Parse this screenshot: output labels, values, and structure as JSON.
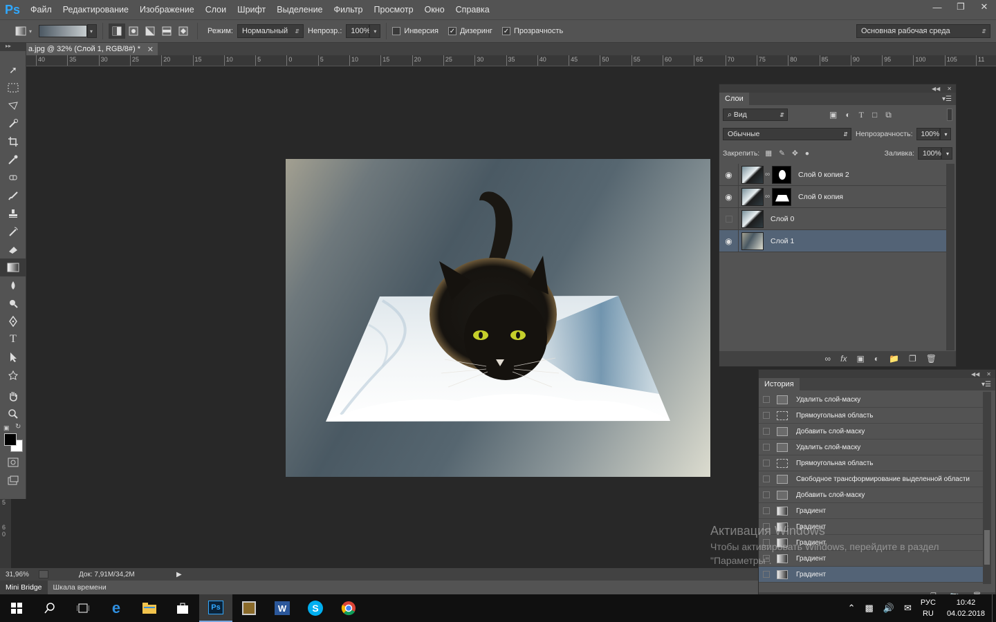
{
  "app": {
    "logo": "Ps",
    "menu": [
      "Файл",
      "Редактирование",
      "Изображение",
      "Слои",
      "Шрифт",
      "Выделение",
      "Фильтр",
      "Просмотр",
      "Окно",
      "Справка"
    ],
    "window_controls": [
      "minimize",
      "restore",
      "close"
    ]
  },
  "options": {
    "mode_label": "Режим:",
    "mode_value": "Нормальный",
    "opacity_label": "Непрозр.:",
    "opacity_value": "100%",
    "inverse_label": "Инверсия",
    "inverse_checked": false,
    "dither_label": "Дизеринг",
    "dither_checked": true,
    "transparency_label": "Прозрачность",
    "transparency_checked": true,
    "workspace": "Основная рабочая среда"
  },
  "document": {
    "tab_title": "a.jpg @ 32% (Слой 1, RGB/8#) *",
    "ruler_ticks": [
      "40",
      "35",
      "30",
      "25",
      "20",
      "15",
      "10",
      "5",
      "0",
      "5",
      "10",
      "15",
      "20",
      "25",
      "30",
      "35",
      "40",
      "45",
      "50",
      "55",
      "60",
      "65",
      "70",
      "75",
      "80",
      "85",
      "90",
      "95",
      "100",
      "105",
      "11"
    ],
    "vertical_ruler": [
      "5",
      "6",
      "0"
    ]
  },
  "status": {
    "zoom": "31,96%",
    "doc_size": "Док: 7,91M/34,2M"
  },
  "bottom_tabs": [
    "Mini Bridge",
    "Шкала времени"
  ],
  "layers_panel": {
    "tab": "Слои",
    "filter": "Вид",
    "blend": "Обычные",
    "opacity_label": "Непрозрачность:",
    "opacity_value": "100%",
    "lock_label": "Закрепить:",
    "fill_label": "Заливка:",
    "fill_value": "100%",
    "layers": [
      {
        "name": "Слой 0 копия 2",
        "visible": true,
        "has_mask": true,
        "selected": false
      },
      {
        "name": "Слой 0 копия",
        "visible": true,
        "has_mask": true,
        "selected": false
      },
      {
        "name": "Слой 0",
        "visible": false,
        "has_mask": false,
        "selected": false
      },
      {
        "name": "Слой 1",
        "visible": true,
        "has_mask": false,
        "selected": true
      }
    ]
  },
  "history_panel": {
    "tab": "История",
    "items": [
      {
        "label": "Удалить слой-маску",
        "icon": "doc-icon"
      },
      {
        "label": "Прямоугольная область",
        "icon": "marquee-icon"
      },
      {
        "label": "Добавить слой-маску",
        "icon": "doc-icon"
      },
      {
        "label": "Удалить слой-маску",
        "icon": "doc-icon"
      },
      {
        "label": "Прямоугольная область",
        "icon": "marquee-icon"
      },
      {
        "label": "Свободное трансформирование выделенной области",
        "icon": "doc-icon"
      },
      {
        "label": "Добавить слой-маску",
        "icon": "doc-icon"
      },
      {
        "label": "Градиент",
        "icon": "gradient-icon"
      },
      {
        "label": "Градиент",
        "icon": "gradient-icon"
      },
      {
        "label": "Градиент",
        "icon": "gradient-icon"
      },
      {
        "label": "Градиент",
        "icon": "gradient-icon"
      },
      {
        "label": "Градиент",
        "icon": "gradient-icon",
        "selected": true
      }
    ]
  },
  "watermark": {
    "title": "Активация Windows",
    "text": "Чтобы активировать Windows, перейдите в раздел \"Параметры\"."
  },
  "taskbar": {
    "lang_top": "РУС",
    "lang_bottom": "RU",
    "time": "10:42",
    "date": "04.02.2018"
  }
}
